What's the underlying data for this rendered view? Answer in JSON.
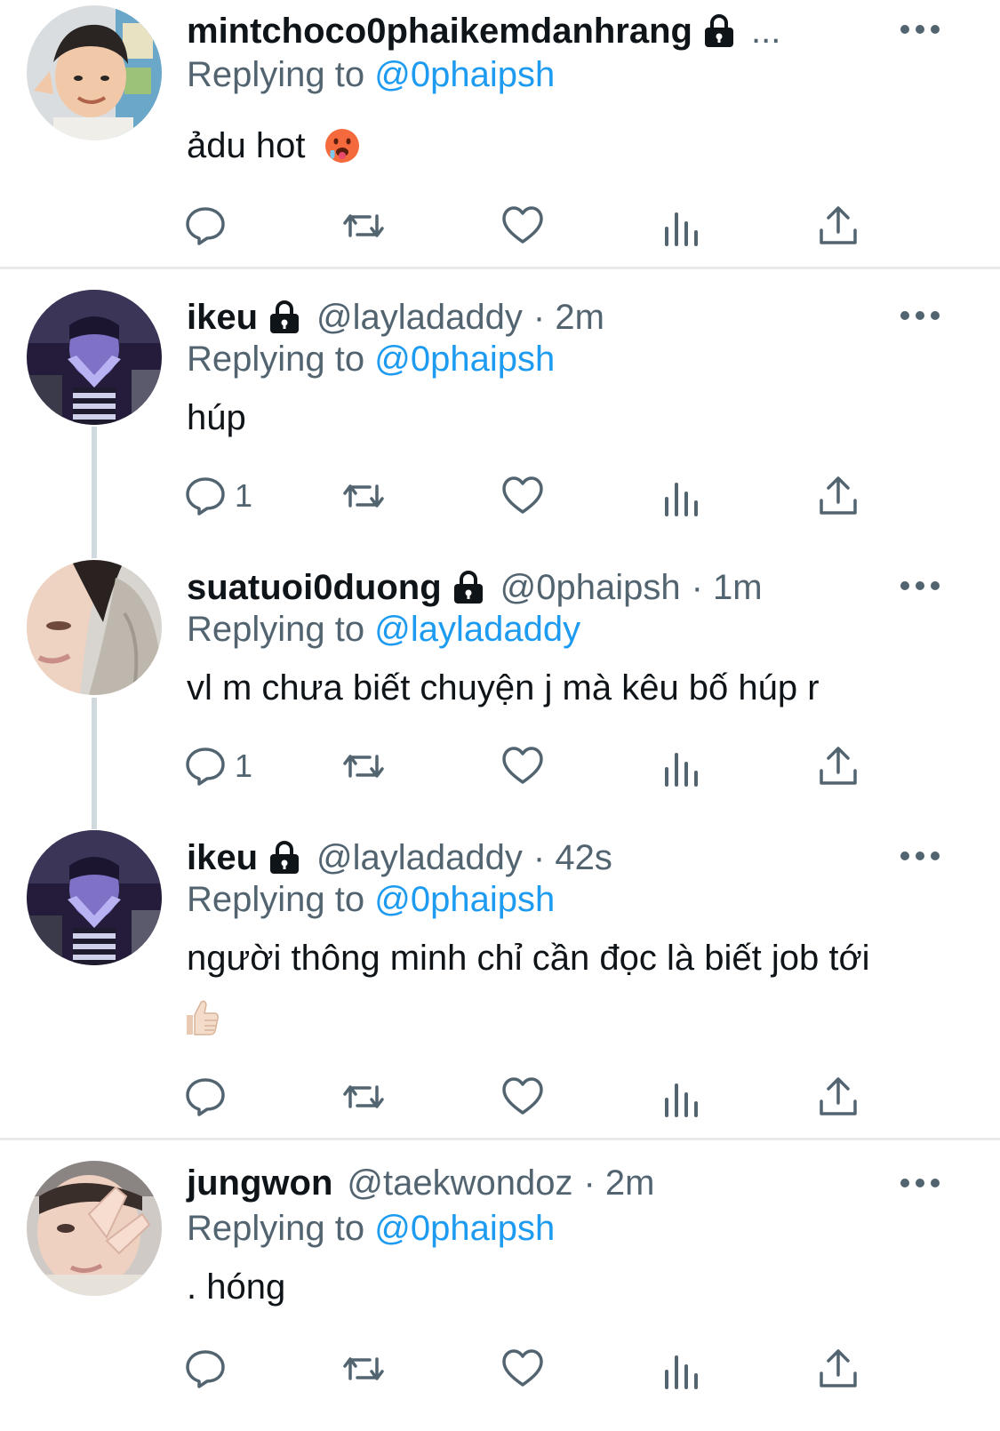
{
  "tweets": [
    {
      "name": "mintchoco0phaikemdanhrang",
      "handle": "",
      "time": "",
      "truncation": "...",
      "replying_prefix": "Replying to ",
      "replying_to": "@0phaipsh",
      "text": "ảdu hot",
      "text_emoji": "hot-face-emoji",
      "reply_count": "",
      "avatar": "child-photo-avatar"
    },
    {
      "name": "ikeu",
      "handle": "@layladaddy",
      "time": "· 2m",
      "replying_prefix": "Replying to ",
      "replying_to": "@0phaipsh",
      "text": "húp",
      "reply_count": "1",
      "avatar": "purple-light-photo-avatar"
    },
    {
      "name": "suatuoi0duong",
      "handle": "@0phaipsh",
      "time": "· 1m",
      "replying_prefix": "Replying to ",
      "replying_to": "@layladaddy",
      "text": "vl m chưa biết chuyện j mà kêu bố húp r",
      "reply_count": "1",
      "avatar": "face-closeup-avatar"
    },
    {
      "name": "ikeu",
      "handle": "@layladaddy",
      "time": "· 42s",
      "replying_prefix": "Replying to ",
      "replying_to": "@0phaipsh",
      "text": "người thông minh chỉ cần đọc là biết job tới",
      "text_emoji": "thumbs-up-emoji",
      "reply_count": "",
      "avatar": "purple-light-photo-avatar"
    },
    {
      "name": "jungwon",
      "handle": "@taekwondoz",
      "time": "· 2m",
      "replying_prefix": "Replying to ",
      "replying_to": "@0phaipsh",
      "text": ". hóng",
      "reply_count": "",
      "avatar": "hand-face-photo-avatar"
    }
  ],
  "icons": {
    "reply": "reply-icon",
    "retweet": "retweet-icon",
    "like": "like-icon",
    "views": "views-icon",
    "share": "share-icon",
    "more": "more-icon",
    "lock": "lock-icon"
  },
  "colors": {
    "mention": "#1d9bf0",
    "secondary_text": "#536471",
    "primary_text": "#0f1419",
    "divider": "#e7e9ea",
    "thread_line": "#cfd9de"
  }
}
